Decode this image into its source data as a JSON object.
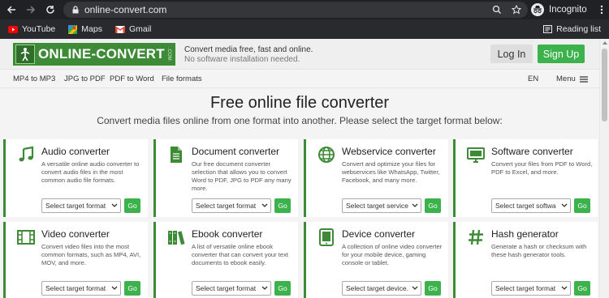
{
  "browser": {
    "url": "online-convert.com",
    "profile_label": "Incognito",
    "bookmarks": [
      {
        "label": "YouTube",
        "icon": "youtube-icon"
      },
      {
        "label": "Maps",
        "icon": "maps-icon"
      },
      {
        "label": "Gmail",
        "icon": "gmail-icon"
      }
    ],
    "reading_list_label": "Reading list"
  },
  "header": {
    "logo_text": "ONLINE-CONVERT",
    "logo_com": ".COM",
    "tagline_line1": "Convert media free, fast and online.",
    "tagline_line2": "No software installation needed.",
    "login_label": "Log In",
    "signup_label": "Sign Up"
  },
  "nav": {
    "links": [
      "MP4 to MP3",
      "JPG to PDF",
      "PDF to Word",
      "File formats"
    ],
    "lang_label": "EN",
    "menu_label": "Menu"
  },
  "main": {
    "title": "Free online file converter",
    "subtitle": "Convert media files online from one format into another. Please select the target format below:",
    "go_label": "Go",
    "cards": [
      {
        "title": "Audio converter",
        "desc": "A versatile online audio converter to convert audio files in the most common audio file formats.",
        "select": "Select target format",
        "icon": "music-note-icon"
      },
      {
        "title": "Document converter",
        "desc": "Our free document converter selection that allows you to convert Word to PDF, JPG to PDF any many more.",
        "select": "Select target format",
        "icon": "document-icon"
      },
      {
        "title": "Webservice converter",
        "desc": "Convert and optimize your files for webservices like WhatsApp, Twitter, Facebook, and many more.",
        "select": "Select target service",
        "icon": "globe-icon"
      },
      {
        "title": "Software converter",
        "desc": "Convert your files from PDF to Word, PDF to Excel, and more.",
        "select": "Select target softwa",
        "icon": "monitor-icon"
      },
      {
        "title": "Video converter",
        "desc": "Convert video files into the most common formats, such as MP4, AVI, MOV, and more.",
        "select": "Select target format",
        "icon": "film-icon"
      },
      {
        "title": "Ebook converter",
        "desc": "A list of versatile online ebook converter that can convert your text documents to ebook easily.",
        "select": "Select target format",
        "icon": "books-icon"
      },
      {
        "title": "Device converter",
        "desc": "A collection of online video converter for your mobile device, gaming console or tablet.",
        "select": "Select target device.",
        "icon": "tablet-icon"
      },
      {
        "title": "Hash generator",
        "desc": "Generate a hash or checksum with these hash generator tools.",
        "select": "Select target format",
        "icon": "hash-icon"
      }
    ]
  },
  "colors": {
    "brand_green": "#3e8b37",
    "button_green": "#3cb24c",
    "chrome_dark": "#202124"
  }
}
